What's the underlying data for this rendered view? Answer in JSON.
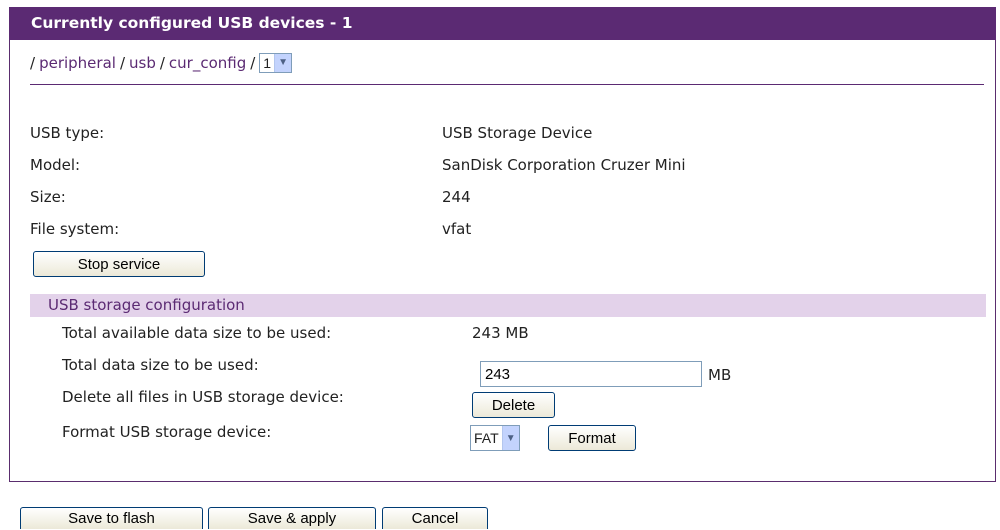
{
  "header": {
    "title": "Currently configured USB devices - 1"
  },
  "breadcrumb": {
    "sep": "/",
    "items": [
      "peripheral",
      "usb",
      "cur_config"
    ],
    "selector_value": "1"
  },
  "device": {
    "type_label": "USB type:",
    "type_value": "USB Storage Device",
    "model_label": "Model:",
    "model_value": "SanDisk Corporation Cruzer Mini",
    "size_label": "Size:",
    "size_value": "244",
    "fs_label": "File system:",
    "fs_value": "vfat",
    "stop_button": "Stop service"
  },
  "storage": {
    "section_title": "USB storage configuration",
    "available_label": "Total available data size to be used:",
    "available_value": "243 MB",
    "used_label": "Total data size to be used:",
    "used_value": "243",
    "used_unit": "MB",
    "delete_label": "Delete all files in USB storage device:",
    "delete_button": "Delete",
    "format_label": "Format USB storage device:",
    "format_select": "FAT",
    "format_button": "Format"
  },
  "footer": {
    "save_flash": "Save to flash",
    "save_apply": "Save & apply",
    "cancel": "Cancel"
  }
}
